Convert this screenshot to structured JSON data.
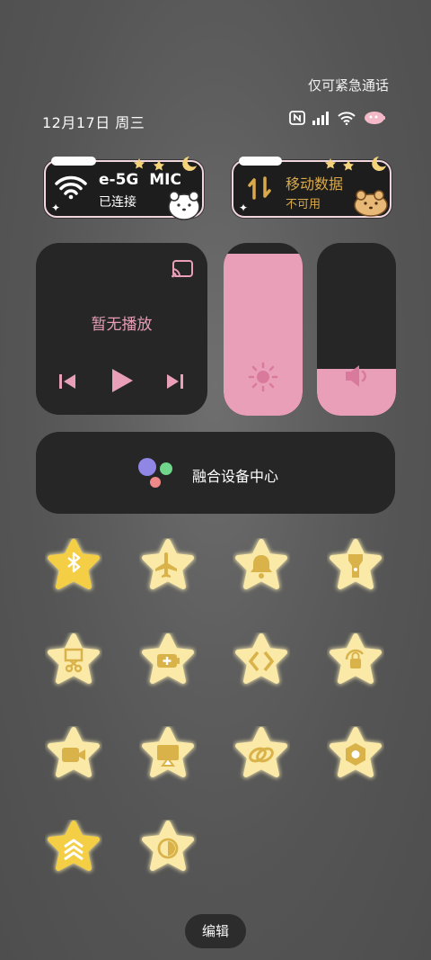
{
  "status": {
    "emergency_note": "仅可紧急通话",
    "date": "12月17日 周三"
  },
  "wifi": {
    "network_name": "e-5G  MIC",
    "state": "已连接"
  },
  "cellular": {
    "title": "移动数据",
    "state": "不可用"
  },
  "media": {
    "now_playing": "暂无播放"
  },
  "brightness": {
    "level": 0.94
  },
  "volume": {
    "level": 0.27
  },
  "device_hub": {
    "label": "融合设备中心"
  },
  "toggles": [
    {
      "icon": "bluetooth-icon"
    },
    {
      "icon": "airplane-icon"
    },
    {
      "icon": "bell-icon"
    },
    {
      "icon": "flashlight-icon"
    },
    {
      "icon": "screenshot-icon"
    },
    {
      "icon": "battery-saver-icon"
    },
    {
      "icon": "nfc-icon"
    },
    {
      "icon": "rotation-lock-icon"
    },
    {
      "icon": "screen-record-icon"
    },
    {
      "icon": "screen-cast-icon"
    },
    {
      "icon": "link-icon"
    },
    {
      "icon": "eye-comfort-icon"
    },
    {
      "icon": "performance-mode-icon"
    },
    {
      "icon": "dark-mode-icon"
    }
  ],
  "footer": {
    "edit_label": "编辑"
  },
  "colors": {
    "accent_pink": "#e99fb8",
    "star_yellow": "#f6dd7c",
    "star_glyph": "#d9b24a",
    "tile_dark": "#262626"
  }
}
